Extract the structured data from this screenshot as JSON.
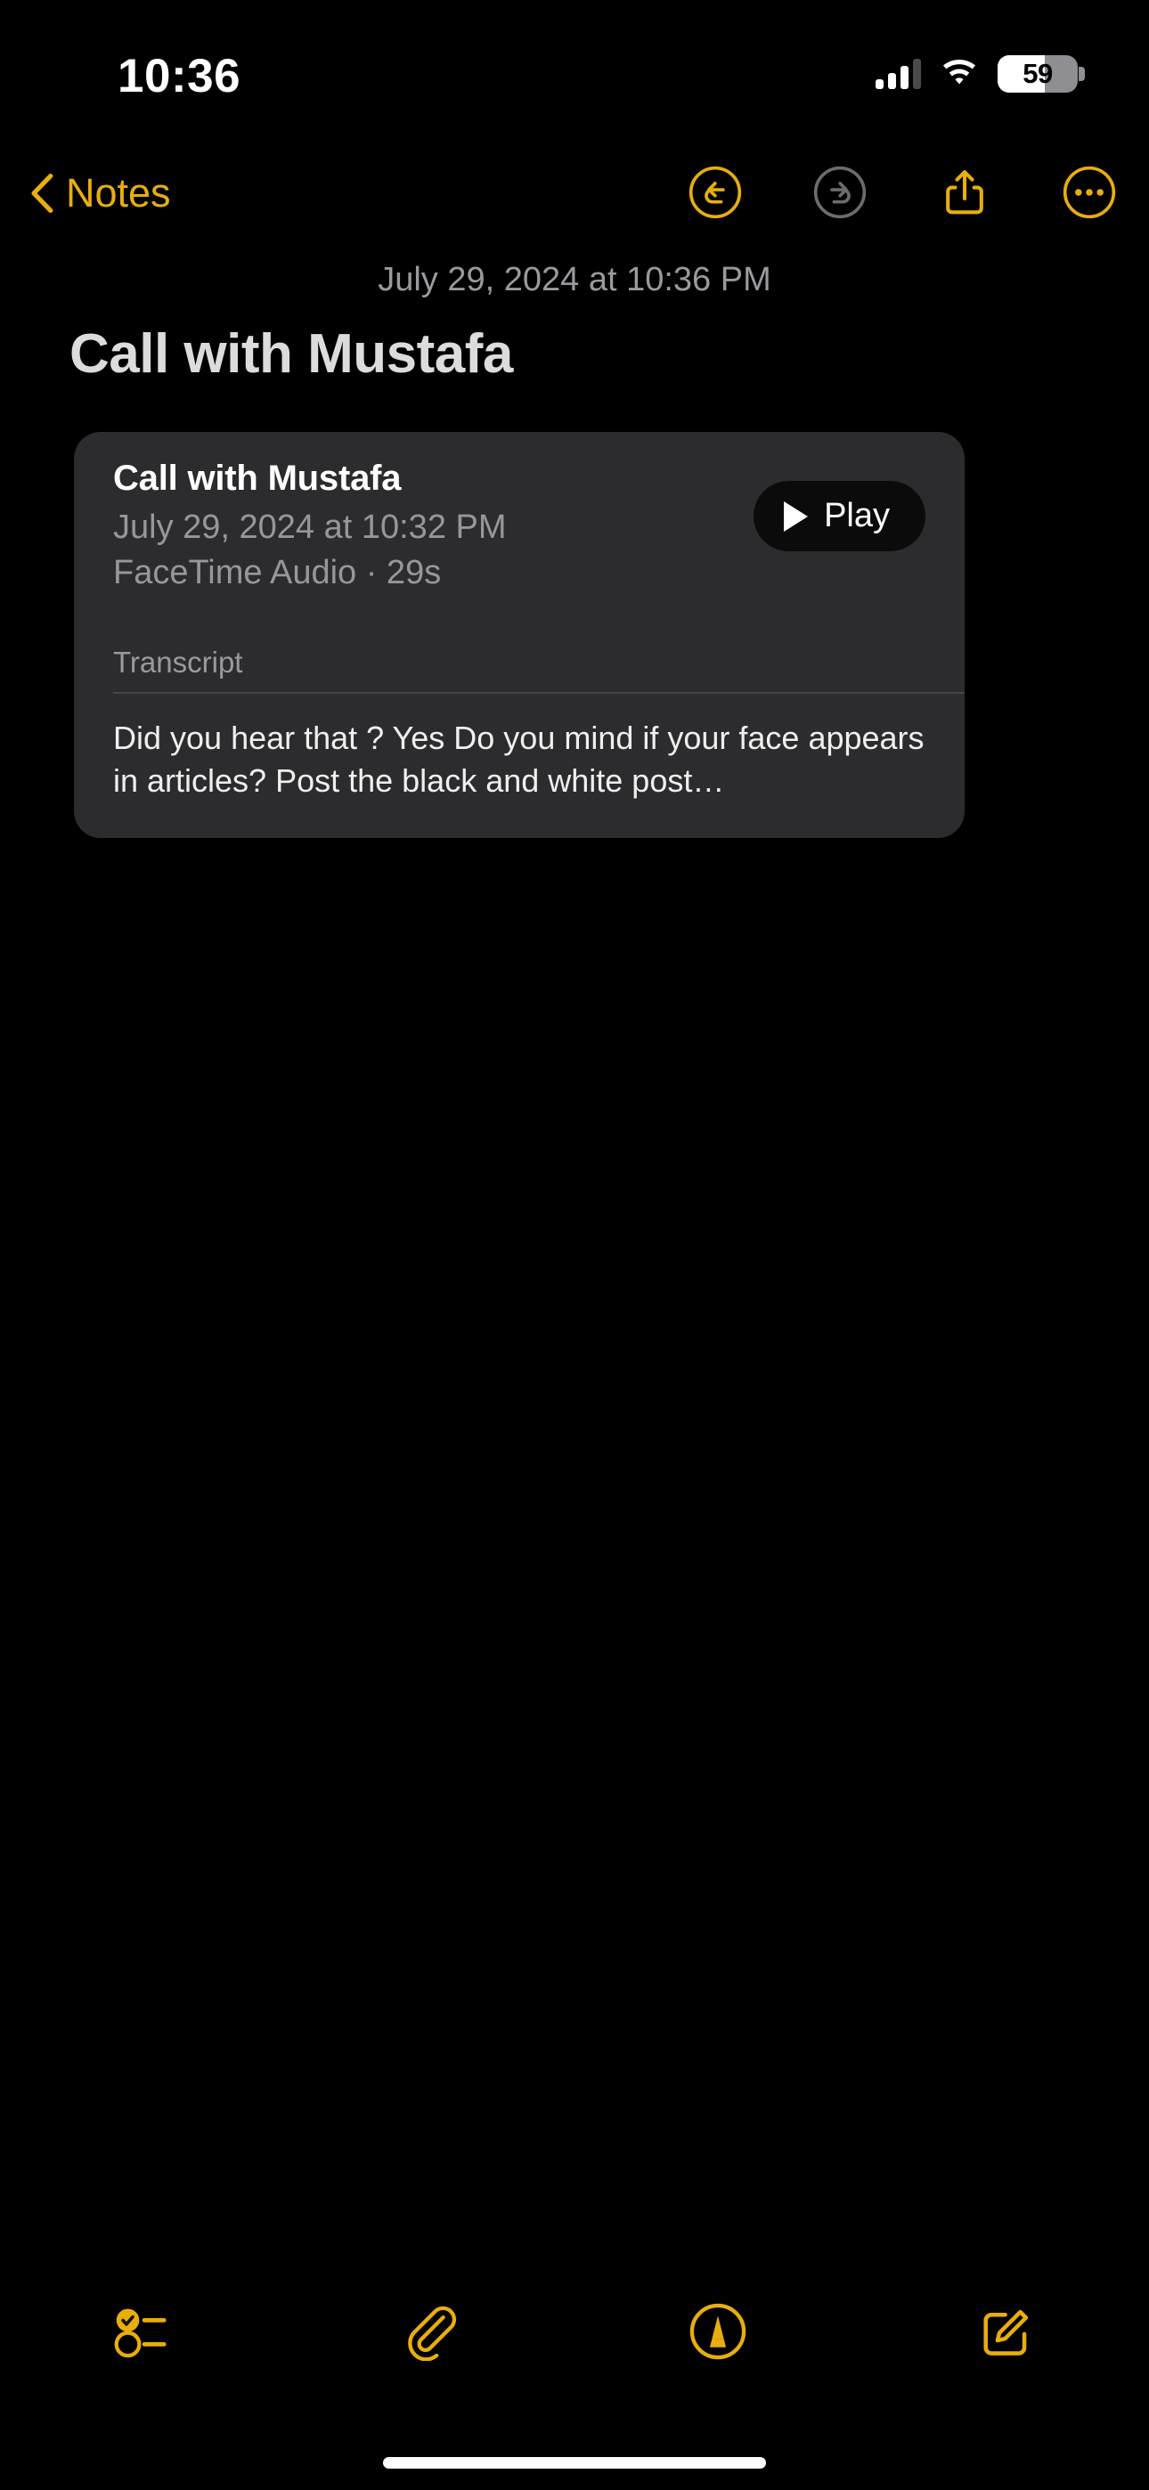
{
  "theme": {
    "background": "#000000",
    "accent": "#E8AE0E",
    "card_background": "#2C2C2E",
    "disabled_icon": "#6b6b70",
    "secondary_text": "#97979b",
    "title_text": "#DCDCDC"
  },
  "status_bar": {
    "time": "10:36",
    "cellular_icon": "cellular-bars-icon",
    "cellular_bars_filled": 3,
    "cellular_bars_total": 4,
    "wifi_icon": "wifi-icon",
    "battery_percent": "59",
    "battery_level": 59
  },
  "nav_bar": {
    "back_label": "Notes",
    "back_icon": "chevron-left-icon",
    "actions": [
      {
        "name": "undo-button",
        "icon": "undo-circle-icon",
        "enabled": true
      },
      {
        "name": "redo-button",
        "icon": "redo-circle-icon",
        "enabled": false
      },
      {
        "name": "share-button",
        "icon": "share-icon",
        "enabled": true
      },
      {
        "name": "more-button",
        "icon": "ellipsis-circle-icon",
        "enabled": true
      }
    ]
  },
  "note": {
    "date": "July 29, 2024 at 10:36 PM",
    "title": "Call with Mustafa"
  },
  "audio_card": {
    "title": "Call with Mustafa",
    "recorded_at": "July 29, 2024 at 10:32 PM",
    "meta": "FaceTime Audio · 29s",
    "call_type": "FaceTime Audio",
    "duration": "29s",
    "play_label": "Play",
    "play_icon": "play-triangle-icon",
    "transcript_label": "Transcript",
    "transcript_text": "Did you hear that ? Yes Do you mind if your face appears in articles? Post the black and white post…"
  },
  "toolbar": {
    "items": [
      {
        "name": "checklist-button",
        "icon": "checklist-icon"
      },
      {
        "name": "attachment-button",
        "icon": "paperclip-icon"
      },
      {
        "name": "markup-button",
        "icon": "markup-pen-circle-icon"
      },
      {
        "name": "compose-button",
        "icon": "compose-square-pencil-icon"
      }
    ]
  }
}
